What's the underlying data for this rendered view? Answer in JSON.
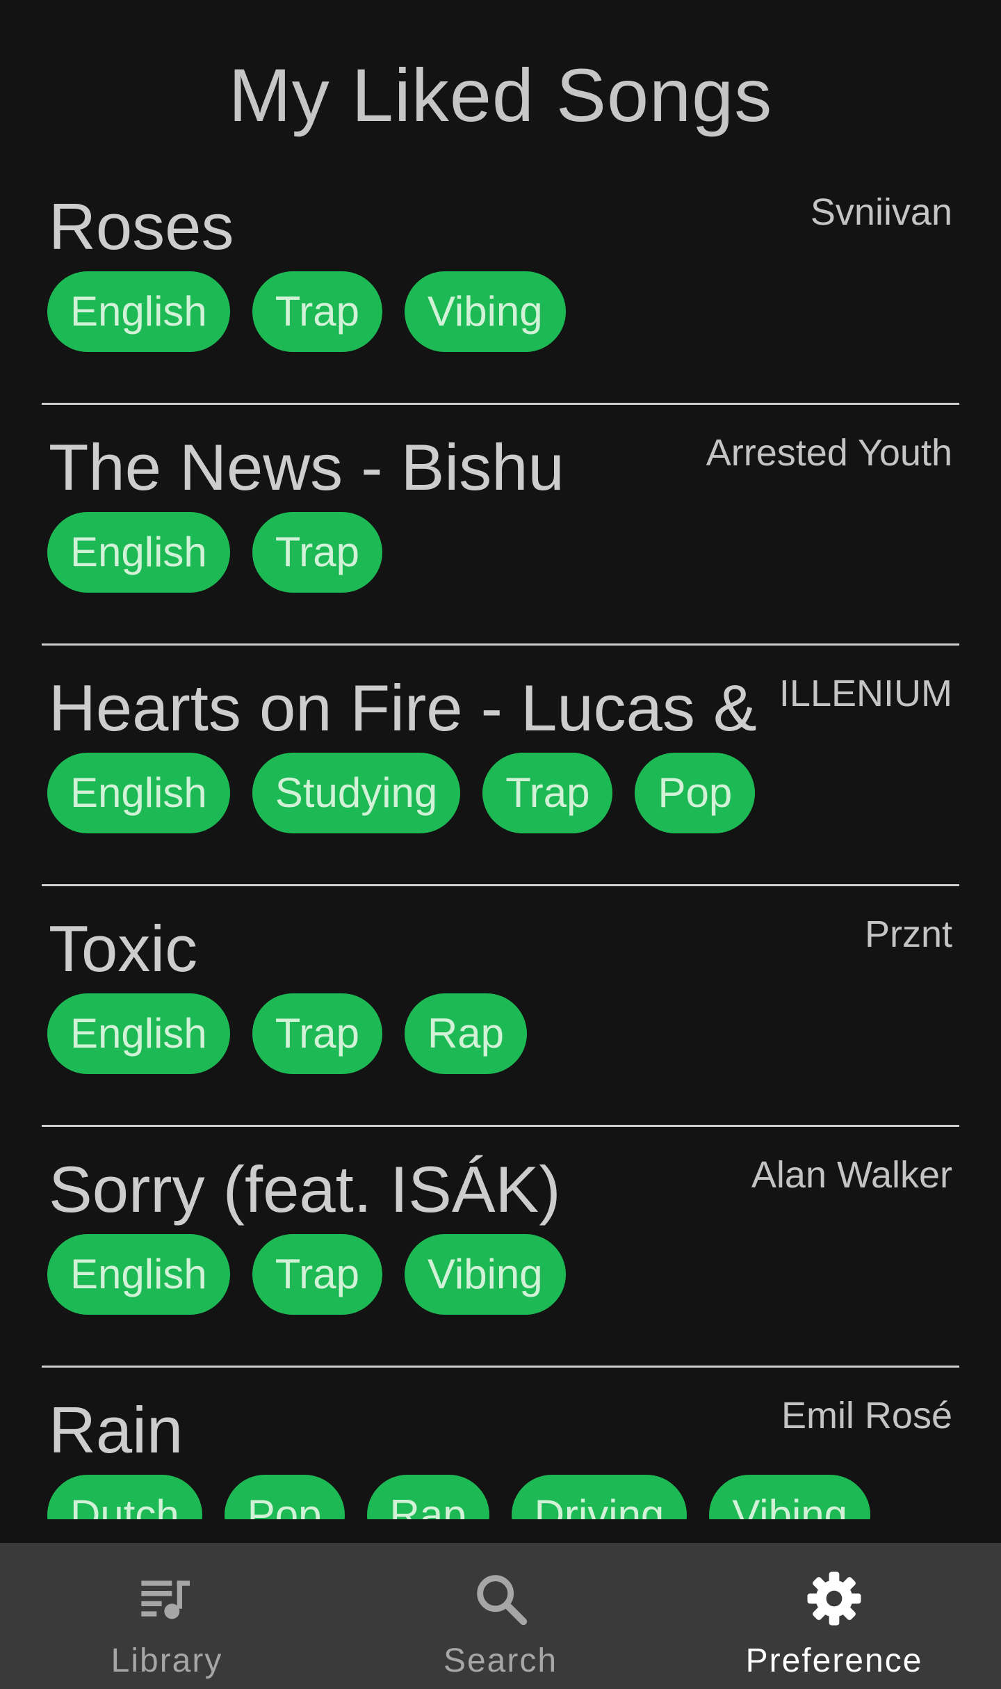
{
  "header": {
    "title": "My Liked Songs"
  },
  "songs": [
    {
      "title": "Roses",
      "artist": "Svniivan",
      "tags": [
        "English",
        "Trap",
        "Vibing"
      ]
    },
    {
      "title": "The News - Bishu",
      "artist": "Arrested Youth",
      "tags": [
        "English",
        "Trap"
      ]
    },
    {
      "title": "Hearts on Fire - Lucas &",
      "artist": "ILLENIUM",
      "tags": [
        "English",
        "Studying",
        "Trap",
        "Pop"
      ]
    },
    {
      "title": "Toxic",
      "artist": "Prznt",
      "tags": [
        "English",
        "Trap",
        "Rap"
      ]
    },
    {
      "title": "Sorry (feat. ISÁK)",
      "artist": "Alan Walker",
      "tags": [
        "English",
        "Trap",
        "Vibing"
      ]
    },
    {
      "title": "Rain",
      "artist": "Emil Rosé",
      "tags": [
        "Dutch",
        "Pop",
        "Rap",
        "Driving",
        "Vibing"
      ]
    }
  ],
  "nav": {
    "items": [
      {
        "label": "Library",
        "icon": "library-music-icon",
        "active": false
      },
      {
        "label": "Search",
        "icon": "search-icon",
        "active": false
      },
      {
        "label": "Preference",
        "icon": "gear-icon",
        "active": true
      }
    ]
  },
  "colors": {
    "background": "#131313",
    "tag": "#1db954",
    "nav_background": "#3a3a3a",
    "active_nav": "#ffffff",
    "inactive_nav": "#a6a6a6"
  }
}
